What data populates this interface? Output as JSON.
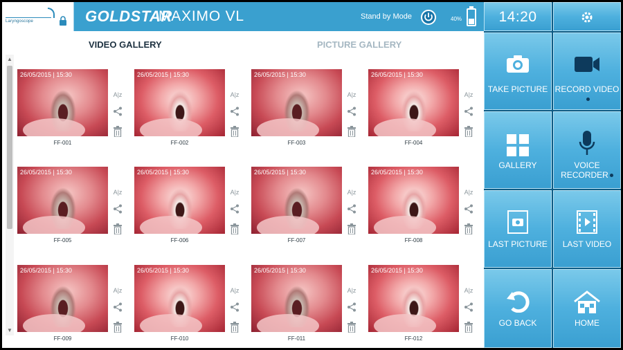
{
  "header": {
    "logo_text": "Laryngoscope",
    "brand": "GOLDSTAR",
    "model": "MAXIMO VL",
    "standby_label": "Stand by Mode",
    "battery_percent": "40%",
    "battery_level": 0.4,
    "accent_color": "#3aa0cf"
  },
  "tabs": {
    "video": "VIDEO GALLERY",
    "picture": "PICTURE GALLERY"
  },
  "actions": {
    "rename": "A|z"
  },
  "gallery": [
    {
      "timestamp": "26/05/2015 | 15:30",
      "caption": "FF-001"
    },
    {
      "timestamp": "26/05/2015 | 15:30",
      "caption": "FF-002"
    },
    {
      "timestamp": "26/05/2015 | 15:30",
      "caption": "FF-003"
    },
    {
      "timestamp": "26/05/2015 | 15:30",
      "caption": "FF-004"
    },
    {
      "timestamp": "26/05/2015 | 15:30",
      "caption": "FF-005"
    },
    {
      "timestamp": "26/05/2015 | 15:30",
      "caption": "FF-006"
    },
    {
      "timestamp": "26/05/2015 | 15:30",
      "caption": "FF-007"
    },
    {
      "timestamp": "26/05/2015 | 15:30",
      "caption": "FF-008"
    },
    {
      "timestamp": "26/05/2015 | 15:30",
      "caption": "FF-009"
    },
    {
      "timestamp": "26/05/2015 | 15:30",
      "caption": "FF-010"
    },
    {
      "timestamp": "26/05/2015 | 15:30",
      "caption": "FF-011"
    },
    {
      "timestamp": "26/05/2015 | 15:30",
      "caption": "FF-012"
    }
  ],
  "panel": {
    "clock": "14:20",
    "take_picture": "TAKE PICTURE",
    "record_video": "RECORD VIDEO",
    "gallery": "GALLERY",
    "voice_recorder": "VOICE RECORDER",
    "last_picture": "LAST PICTURE",
    "last_video": "LAST VIDEO",
    "go_back": "GO BACK",
    "home": "HOME"
  }
}
